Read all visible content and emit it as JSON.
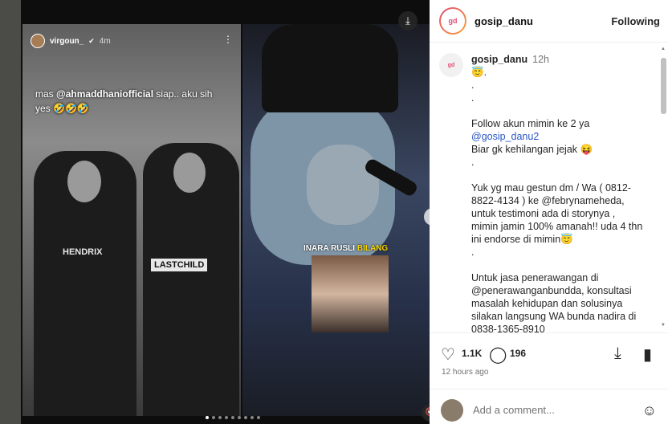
{
  "story": {
    "username": "virgoun_",
    "time": "4m",
    "caption_prefix": "mas ",
    "caption_mention": "@ahmaddhaniofficial",
    "caption_suffix": " siap.. aku sih yes 🤣🤣🤣",
    "shirt1": "HENDRIX",
    "shirt2": "LASTCHILD"
  },
  "clip": {
    "label_name": "INARA RUSLI",
    "label_word": "BILANG"
  },
  "carousel": {
    "total": 9,
    "active": 0
  },
  "post": {
    "username": "gosip_danu",
    "follow_label": "Following",
    "avatar_text": "gd",
    "caption_time": "12h",
    "caption_lines": [
      "😇.",
      ".",
      ".",
      "",
      "Follow akun mimin ke 2 ya",
      "@gosip_danu2",
      "Biar gk kehilangan jejak 😝",
      ".",
      "",
      "Yuk yg mau gestun dm / Wa ( 0812-8822-4134 ) ke @febrynameheda, untuk testimoni ada di storynya , mimin jamin 100% amanah!! uda 4 thn ini endorse di mimin😇",
      ".",
      "",
      "Untuk jasa penerawangan di @penerawanganbundda, konsultasi masalah kehidupan dan solusinya silakan langsung WA bunda nadira di 0838-1365-8910"
    ],
    "likes": "1.1K",
    "comments": "196",
    "time_ago": "12 hours ago",
    "comment_placeholder": "Add a comment..."
  },
  "colors": {
    "accent_link": "#2a56c6",
    "text": "#262626",
    "muted": "#737373"
  }
}
